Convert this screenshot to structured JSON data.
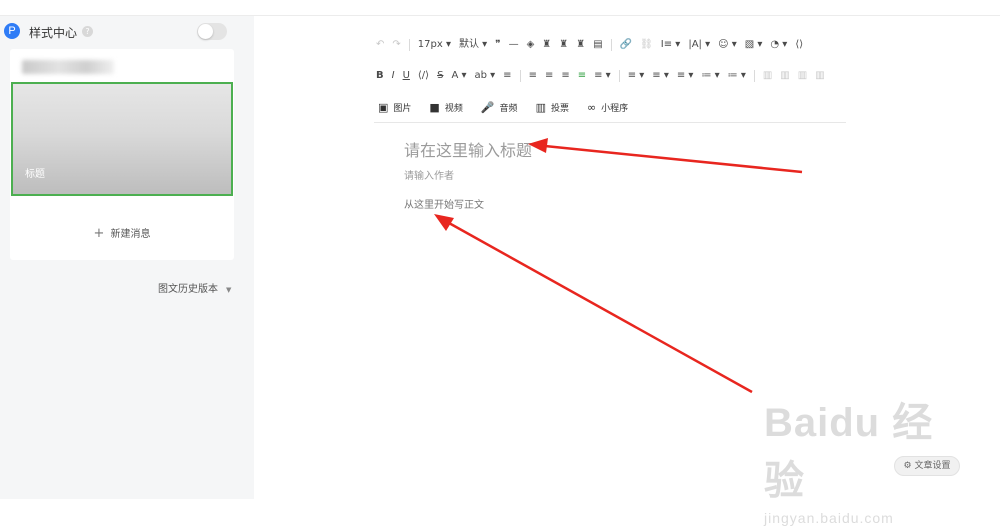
{
  "sidebar": {
    "badge": "P",
    "title": "样式中心",
    "help": "?",
    "cover_title": "标题",
    "new_message": "新建消息",
    "history_label": "图文历史版本"
  },
  "toolbar": {
    "row1": [
      "↶",
      "↷",
      "17px ▾",
      "默认 ▾",
      "❞",
      "—",
      "◈",
      "♜",
      "♜",
      "♜",
      "▤",
      "▥",
      "🔗",
      "⛓",
      "Ⅰ≡ ▾",
      "|A| ▾",
      "☺ ▾",
      "▧ ▾",
      "◔ ▾",
      "⟨⟩"
    ],
    "row2": [
      "B",
      "I",
      "U",
      "⟨/⟩",
      "S",
      "A ▾",
      "ab ▾",
      "≡",
      "≡",
      "≡",
      "≡",
      "≡",
      "≡ ▾",
      "≡ ▾",
      "≡ ▾",
      "≡ ▾",
      "≔ ▾",
      "≔ ▾",
      "▥",
      "▥",
      "▥",
      "▥"
    ],
    "media": [
      {
        "icon": "▣",
        "label": "图片"
      },
      {
        "icon": "■",
        "label": "视频"
      },
      {
        "icon": "🎤",
        "label": "音频"
      },
      {
        "icon": "▥",
        "label": "投票"
      },
      {
        "icon": "∞",
        "label": "小程序"
      }
    ]
  },
  "editor": {
    "title_placeholder": "请在这里输入标题",
    "author_placeholder": "请输入作者",
    "body_placeholder": "从这里开始写正文"
  },
  "footer": {
    "settings_label": "文章设置"
  },
  "watermark": {
    "main": "Baidu 经验",
    "sub": "jingyan.baidu.com"
  },
  "colors": {
    "accent_blue": "#2f7cf6",
    "selection_green": "#4caf50",
    "annotation_red": "#e8261f"
  }
}
